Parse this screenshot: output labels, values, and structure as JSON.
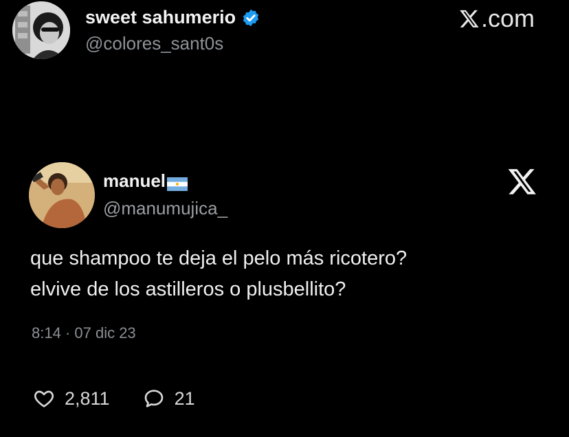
{
  "outer_post": {
    "display_name": "sweet sahumerio",
    "handle": "@colores_sant0s",
    "verified": true,
    "brand_label": ".com",
    "accent_color": "#1d9bf0"
  },
  "embedded_tweet": {
    "display_name": "manuel",
    "handle": "@manumujica_",
    "flag_icon": "argentina-flag-icon",
    "text_lines": [
      "que shampoo te deja el pelo más ricotero?",
      "elvive de los astilleros o plusbellito?"
    ],
    "timestamp": "8:14 · 07 dic 23",
    "likes": "2,811",
    "replies": "21"
  },
  "icons": {
    "verified": "verified-badge-icon",
    "x_logo": "x-logo-icon",
    "like": "heart-icon",
    "reply": "speech-bubble-icon"
  }
}
